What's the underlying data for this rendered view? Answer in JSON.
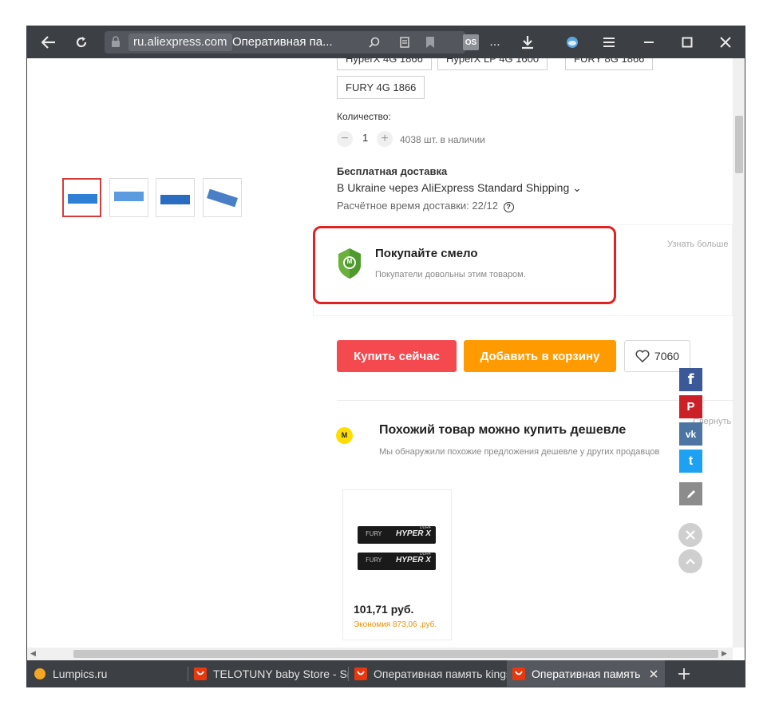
{
  "browser": {
    "url_domain": "ru.aliexpress.com",
    "page_title": "Оперативная па...",
    "ext_badge": "OS",
    "more": "..."
  },
  "product": {
    "options_partial": [
      "HyperX 4G 1866",
      "HyperX LP 4G 1600",
      "FURY 8G 1866"
    ],
    "option_fury": "FURY 4G 1866",
    "quantity_label": "Количество:",
    "quantity_value": "1",
    "minus": "−",
    "plus": "+",
    "stock": "4038 шт. в наличии",
    "shipping_title": "Бесплатная доставка",
    "shipping_method": "В Ukraine через AliExpress Standard Shipping ⌄",
    "delivery_label": "Расчётное время доставки: 22/12",
    "help": "?"
  },
  "buyer_protection": {
    "title": "Покупайте смело",
    "subtitle": "Покупатели довольны этим товаром.",
    "learn_more": "Узнать больше",
    "guard_letter": "M"
  },
  "actions": {
    "buy_now": "Купить сейчас",
    "add_to_cart": "Добавить в корзину",
    "wish_count": "7060"
  },
  "cheaper": {
    "badge": "M",
    "title": "Похожий товар можно купить дешевле",
    "subtitle": "Мы обнаружили похожие предложения дешевле у других продавцов",
    "collapse": "Свернуть",
    "card": {
      "price": "101,71 руб.",
      "saving": "Экономия 873,06 ,руб.",
      "stick_text": "FURY",
      "stick_brand": "HYPER X",
      "stick_label": "DDR4"
    }
  },
  "social": {
    "facebook": "f",
    "pinterest": "P",
    "vk": "vk",
    "twitter": "t"
  },
  "tabs": [
    {
      "label": "Lumpics.ru"
    },
    {
      "label": "TELOTUNY baby Store - Sm"
    },
    {
      "label": "Оперативная память kings"
    },
    {
      "label": "Оперативная память kir"
    }
  ],
  "colors": {
    "buy_now": "#f44a4f",
    "add_to_cart": "#ff9b00",
    "highlight": "#e02222",
    "chrome": "#3c3f44",
    "saving": "#e8920a"
  }
}
